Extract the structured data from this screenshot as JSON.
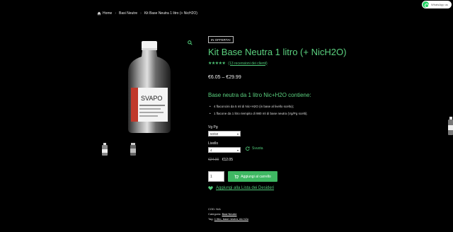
{
  "breadcrumb": {
    "home": "Home",
    "category": "Basi Neutre",
    "current": "Kit Base Neutra 1 litro (+ NicH2O)"
  },
  "whatsapp": {
    "label": "WhatsApp us"
  },
  "product": {
    "badge": "IN OFFERTA!",
    "title": "Kit Base Neutra 1 litro (+ NicH2O)",
    "stars": "★★★★★",
    "reviews_link": "(13 recensioni dei clienti)",
    "price_range": "€6.05 – €29.99",
    "description_title": "Base neutra da 1 litro Nic+H2O contiene:",
    "description_items": [
      "4 flaconcini da 5 ml di Nic+H2O (in base al livello scelto);",
      "1 flacone da 1 litro riempito di 980 ml di base neutra (Vg/Pg scelti)."
    ],
    "bottle_brand": "SVAPO"
  },
  "variations": {
    "vgpg_label": "Vg Pg",
    "vgpg_value": "50/50",
    "level_label": "Livello",
    "level_value": "4",
    "reset_label": "Svuota"
  },
  "variation_price": {
    "old": "€24.00",
    "new": "€12.05"
  },
  "cart": {
    "quantity": "1",
    "add_label": "Aggiungi al carrello"
  },
  "wishlist": {
    "label": "Aggiungi alla Lista dei Desideri"
  },
  "meta": {
    "sku_label": "COD:",
    "sku_value": "N/A",
    "category_label": "Categoria:",
    "category_value": "Basi Neutre",
    "tags_label": "Tag:",
    "tags_value": "1 litro, base neutra, nic h2o"
  },
  "colors": {
    "accent": "#3fb863",
    "link": "#4fc878",
    "background": "#000000"
  }
}
